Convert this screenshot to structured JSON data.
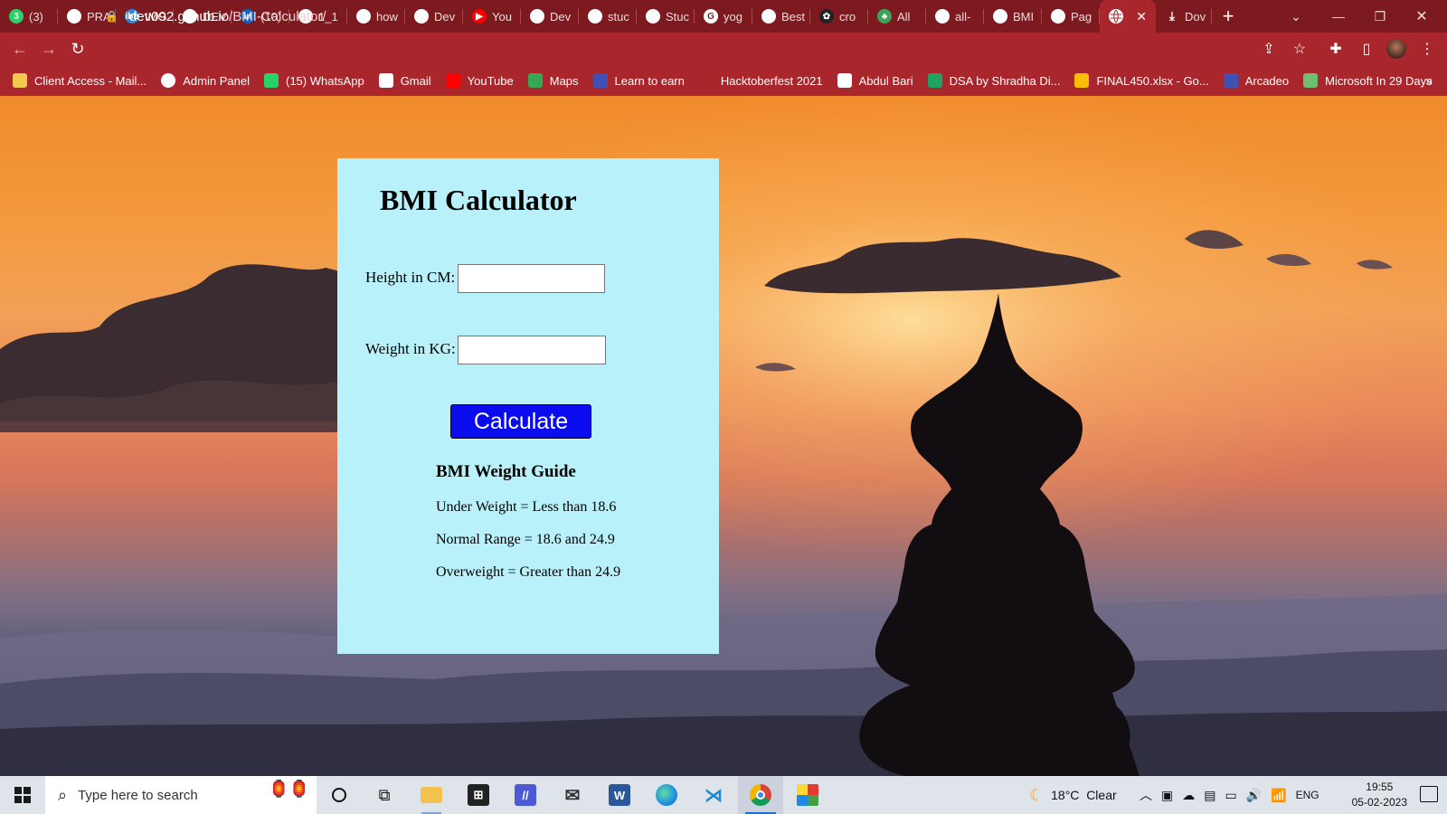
{
  "browser": {
    "tabs": [
      {
        "label": "(3)",
        "icon": "whatsapp-icon",
        "color": "#25d366",
        "glyph": "3"
      },
      {
        "label": "PRA",
        "icon": "globe-icon",
        "color": "#ffffff",
        "glyph": ""
      },
      {
        "label": "IMG",
        "icon": "ibb-icon",
        "color": "#2f86d6",
        "glyph": "ibb"
      },
      {
        "label": "DEV",
        "icon": "globe-icon",
        "color": "#ffffff",
        "glyph": ""
      },
      {
        "label": "(10)",
        "icon": "linkedin-icon",
        "color": "#0a66c2",
        "glyph": "in"
      },
      {
        "label": "1_1",
        "icon": "globe-icon",
        "color": "#ffffff",
        "glyph": ""
      },
      {
        "label": "how",
        "icon": "globe-icon",
        "color": "#ffffff",
        "glyph": ""
      },
      {
        "label": "Dev",
        "icon": "github-icon",
        "color": "#ffffff",
        "glyph": ""
      },
      {
        "label": "You",
        "icon": "youtube-icon",
        "color": "#ff0000",
        "glyph": "▶"
      },
      {
        "label": "Dev",
        "icon": "github-icon",
        "color": "#ffffff",
        "glyph": ""
      },
      {
        "label": "stuc",
        "icon": "github-icon",
        "color": "#ffffff",
        "glyph": ""
      },
      {
        "label": "Stuc",
        "icon": "github-icon",
        "color": "#ffffff",
        "glyph": ""
      },
      {
        "label": "yog",
        "icon": "google-icon",
        "color": "#ffffff",
        "glyph": "G"
      },
      {
        "label": "Best",
        "icon": "globe-icon",
        "color": "#ffffff",
        "glyph": ""
      },
      {
        "label": "cro",
        "icon": "app-icon",
        "color": "#222222",
        "glyph": "✿"
      },
      {
        "label": "All",
        "icon": "leaf-icon",
        "color": "#3aa55a",
        "glyph": "♣"
      },
      {
        "label": "all-",
        "icon": "globe-icon",
        "color": "#ffffff",
        "glyph": ""
      },
      {
        "label": "BMI",
        "icon": "globe-icon",
        "color": "#ffffff",
        "glyph": ""
      },
      {
        "label": "Pag",
        "icon": "github-icon",
        "color": "#ffffff",
        "glyph": ""
      }
    ],
    "active_tab": {
      "label": "",
      "close": "✕"
    },
    "download_tab": {
      "label": "Dov"
    },
    "new_tab": "+",
    "url_host": "dev092.github.io",
    "url_path": "/BMI-Calculator/",
    "bookmarks": [
      {
        "label": "Client Access - Mail...",
        "icon": "mail-icon",
        "color": "#f2c94c"
      },
      {
        "label": "Admin Panel",
        "icon": "globe-icon",
        "color": "#ffffff"
      },
      {
        "label": "(15) WhatsApp",
        "icon": "whatsapp-icon",
        "color": "#25d366"
      },
      {
        "label": "Gmail",
        "icon": "gmail-icon",
        "color": "#ffffff"
      },
      {
        "label": "YouTube",
        "icon": "youtube-icon",
        "color": "#ff0000"
      },
      {
        "label": "Maps",
        "icon": "maps-icon",
        "color": "#34a853"
      },
      {
        "label": "Learn to earn",
        "icon": "bookmark-app-icon",
        "color": "#3f51b5"
      },
      {
        "label": "Hacktoberfest 2021",
        "icon": "hacktoberfest-icon",
        "color": "#a8262c"
      },
      {
        "label": "Abdul Bari",
        "icon": "udemy-icon",
        "color": "#ffffff"
      },
      {
        "label": "DSA by Shradha Di...",
        "icon": "sheets-icon",
        "color": "#1ea362"
      },
      {
        "label": "FINAL450.xlsx - Go...",
        "icon": "drive-icon",
        "color": "#fbbc04"
      },
      {
        "label": "Arcadeo",
        "icon": "bookmark-app-icon",
        "color": "#3f51b5"
      },
      {
        "label": "Microsoft In 29 Days",
        "icon": "infinity-icon",
        "color": "#6fbf73"
      }
    ]
  },
  "page": {
    "title": "BMI Calculator",
    "height_label": "Height in CM:",
    "height_value": "",
    "weight_label": "Weight in KG:",
    "weight_value": "",
    "button_label": "Calculate",
    "guide_title": "BMI Weight Guide",
    "guide_lines": [
      "Under Weight = Less than 18.6",
      "Normal Range = 18.6 and 24.9",
      "Overweight = Greater than 24.9"
    ]
  },
  "taskbar": {
    "search_placeholder": "Type here to search",
    "weather": "18°C  Clear",
    "language": "ENG",
    "time": "19:55",
    "date": "05-02-2023",
    "accent": "#1c6fd1"
  }
}
